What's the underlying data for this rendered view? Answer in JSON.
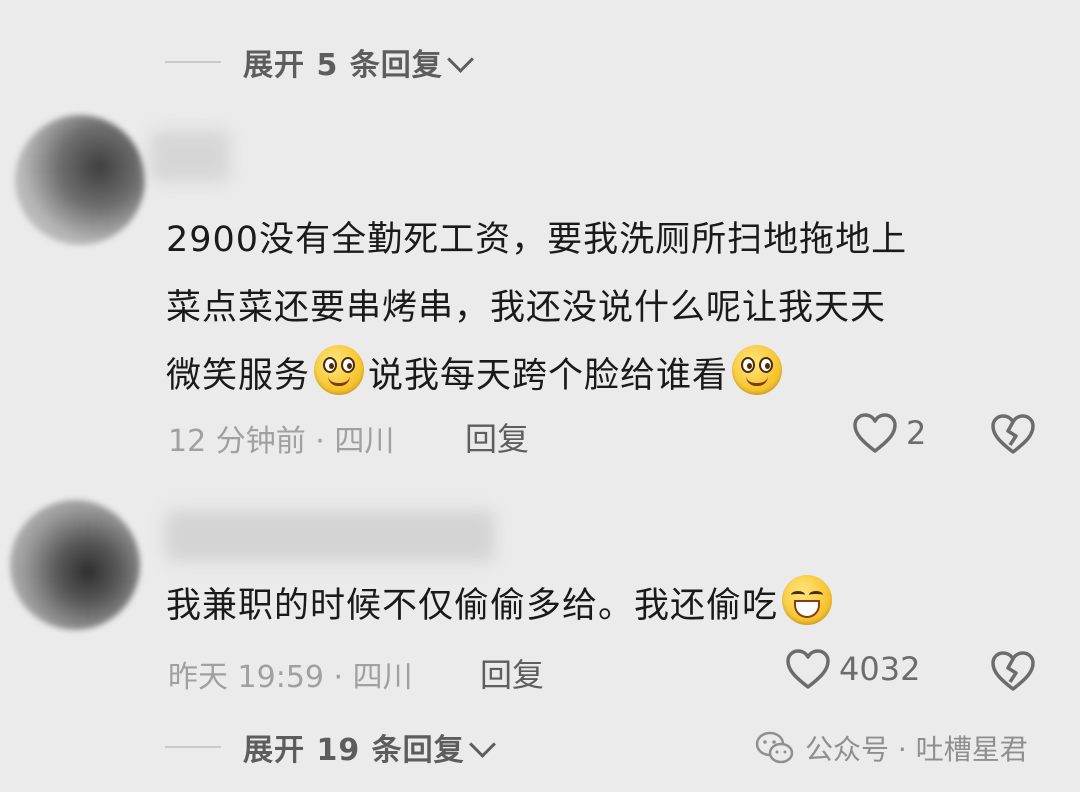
{
  "thread": {
    "expand_top": "展开 5 条回复",
    "expand_bottom": "展开 19 条回复"
  },
  "comments": [
    {
      "text_line1": "2900没有全勤死工资，要我洗厕所扫地拖地上",
      "text_line2": "菜点菜还要串烤串，我还没说什么呢让我天天",
      "text_line3a": "微笑服务",
      "text_line3b": "说我每天跨个脸给谁看",
      "time": "12 分钟前 · 四川",
      "reply_label": "回复",
      "likes": "2"
    },
    {
      "text": "我兼职的时候不仅偷偷多给。我还偷吃",
      "time": "昨天 19:59 · 四川",
      "reply_label": "回复",
      "likes": "4032"
    }
  ],
  "watermark": {
    "label": "公众号 · 吐槽星君"
  },
  "icons": [
    "chevron-down-icon",
    "smile-emoji",
    "grin-emoji",
    "heart-icon",
    "broken-heart-icon",
    "wechat-icon"
  ]
}
